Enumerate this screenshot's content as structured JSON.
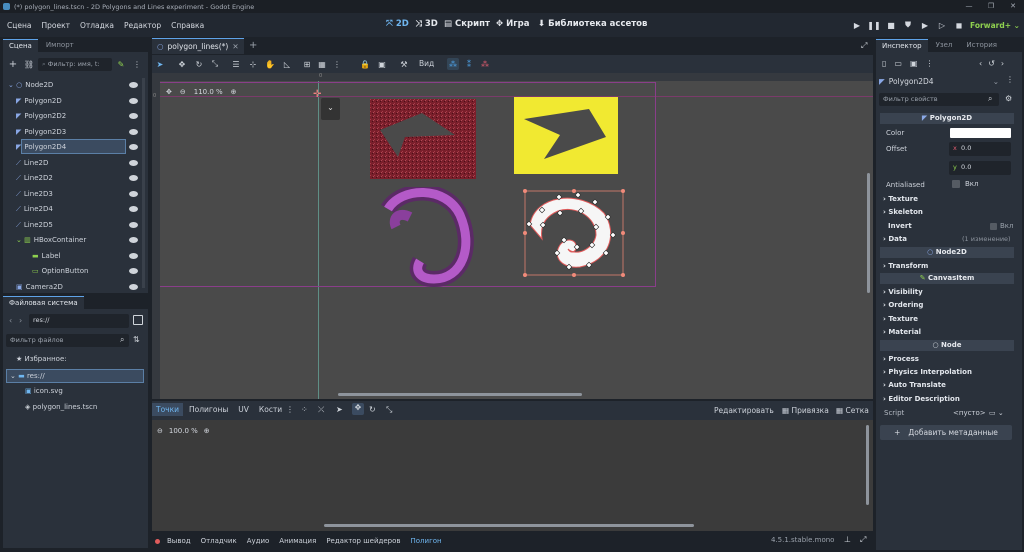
{
  "window": {
    "title": "(*) polygon_lines.tscn - 2D Polygons and Lines experiment - Godot Engine",
    "controls": [
      "—",
      "❐",
      "✕"
    ]
  },
  "menu": [
    "Сцена",
    "Проект",
    "Отладка",
    "Редактор",
    "Справка"
  ],
  "main_buttons": {
    "2d": "2D",
    "3d": "3D",
    "script": "Скрипт",
    "game": "Игра",
    "assets": "Библиотека ассетов"
  },
  "renderer": "Forward+",
  "scene_dock": {
    "tabs": [
      "Сцена",
      "Импорт"
    ],
    "filter_placeholder": "Фильтр: имя, t:",
    "nodes": [
      {
        "label": "Node2D",
        "icon": "node2d-icon",
        "depth": 0
      },
      {
        "label": "Polygon2D",
        "icon": "polygon-icon",
        "depth": 1
      },
      {
        "label": "Polygon2D2",
        "icon": "polygon-icon",
        "depth": 1
      },
      {
        "label": "Polygon2D3",
        "icon": "polygon-icon",
        "depth": 1
      },
      {
        "label": "Polygon2D4",
        "icon": "polygon-icon",
        "depth": 1,
        "selected": true
      },
      {
        "label": "Line2D",
        "icon": "line-icon",
        "depth": 1
      },
      {
        "label": "Line2D2",
        "icon": "line-icon",
        "depth": 1
      },
      {
        "label": "Line2D3",
        "icon": "line-icon",
        "depth": 1
      },
      {
        "label": "Line2D4",
        "icon": "line-icon",
        "depth": 1
      },
      {
        "label": "Line2D5",
        "icon": "line-icon",
        "depth": 1
      },
      {
        "label": "HBoxContainer",
        "icon": "hbox-icon",
        "depth": 1
      },
      {
        "label": "Label",
        "icon": "label-icon",
        "depth": 2
      },
      {
        "label": "OptionButton",
        "icon": "optionbutton-icon",
        "depth": 2
      },
      {
        "label": "Camera2D",
        "icon": "camera-icon",
        "depth": 1
      }
    ]
  },
  "filesystem": {
    "title": "Файловая система",
    "path": "res://",
    "filter_placeholder": "Фильтр файлов",
    "favorites": "Избранное:",
    "items": [
      "res://",
      "icon.svg",
      "polygon_lines.tscn"
    ]
  },
  "editor_tab": "polygon_lines(*)",
  "toolbar": {
    "view_label": "Вид"
  },
  "viewport": {
    "zoom": "110.0 %",
    "ruler_labels": [
      "0",
      "0"
    ]
  },
  "polygon_editor": {
    "tabs": [
      "Точки",
      "Полигоны",
      "UV",
      "Кости"
    ],
    "edit_label": "Редактировать",
    "snap_label": "Привязка",
    "grid_label": "Сетка",
    "zoom": "100.0 %"
  },
  "bottom_bar": {
    "tabs": [
      "Вывод",
      "Отладчик",
      "Аудио",
      "Анимация",
      "Редактор шейдеров",
      "Полигон"
    ],
    "version": "4.5.1.stable.mono"
  },
  "inspector": {
    "tabs": [
      "Инспектор",
      "Узел",
      "История"
    ],
    "object": "Polygon2D4",
    "filter_placeholder": "Фильтр свойств",
    "section_polygon": "Polygon2D",
    "color_label": "Color",
    "offset_label": "Offset",
    "offset_x": "0.0",
    "offset_y": "0.0",
    "x": "x",
    "y": "y",
    "antialiased_label": "Antialiased",
    "antialiased_value": "Вкл",
    "groups_polygon": [
      "Texture",
      "Skeleton"
    ],
    "invert_label": "Invert",
    "invert_value": "Вкл",
    "data_label": "Data",
    "data_changes": "(1 изменение)",
    "section_node2d": "Node2D",
    "transform_label": "Transform",
    "section_canvasitem": "CanvasItem",
    "groups_canvas": [
      "Visibility",
      "Ordering",
      "Texture",
      "Material"
    ],
    "section_node": "Node",
    "groups_node": [
      "Process",
      "Physics Interpolation",
      "Auto Translate",
      "Editor Description"
    ],
    "script_label": "Script",
    "script_value": "<пусто>",
    "add_meta": "Добавить метаданные"
  },
  "colors": {
    "accent": "#5fa3e8",
    "bg": "#1d2229",
    "panel": "#2a313b",
    "viewport": "#4a4a4a",
    "polygon_red": "#7a1f2b",
    "polygon_yellow": "#f1e931",
    "line_purple": "#b45ac8"
  }
}
